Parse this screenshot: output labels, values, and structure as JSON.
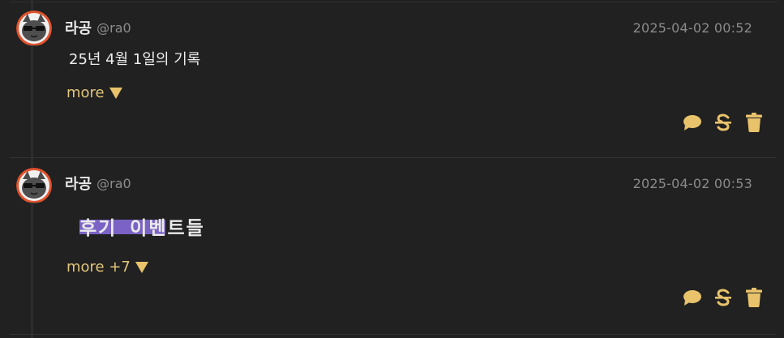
{
  "colors": {
    "background": "#212121",
    "accent": "#e8c36b",
    "highlight": "#7b63c6",
    "timestamp": "#8a8a8a"
  },
  "posts": [
    {
      "author": "라공",
      "handle": "@ra0",
      "timestamp": "2025-04-02 00:52",
      "body": "25년 4월 1일의 기록",
      "more_label": "more",
      "actions": [
        "comment-icon",
        "strikethrough-icon",
        "trash-icon"
      ]
    },
    {
      "author": "라공",
      "handle": "@ra0",
      "timestamp": "2025-04-02 00:53",
      "body": "후기 이벤트들",
      "more_label": "more +7",
      "actions": [
        "comment-icon",
        "strikethrough-icon",
        "trash-icon"
      ]
    }
  ]
}
